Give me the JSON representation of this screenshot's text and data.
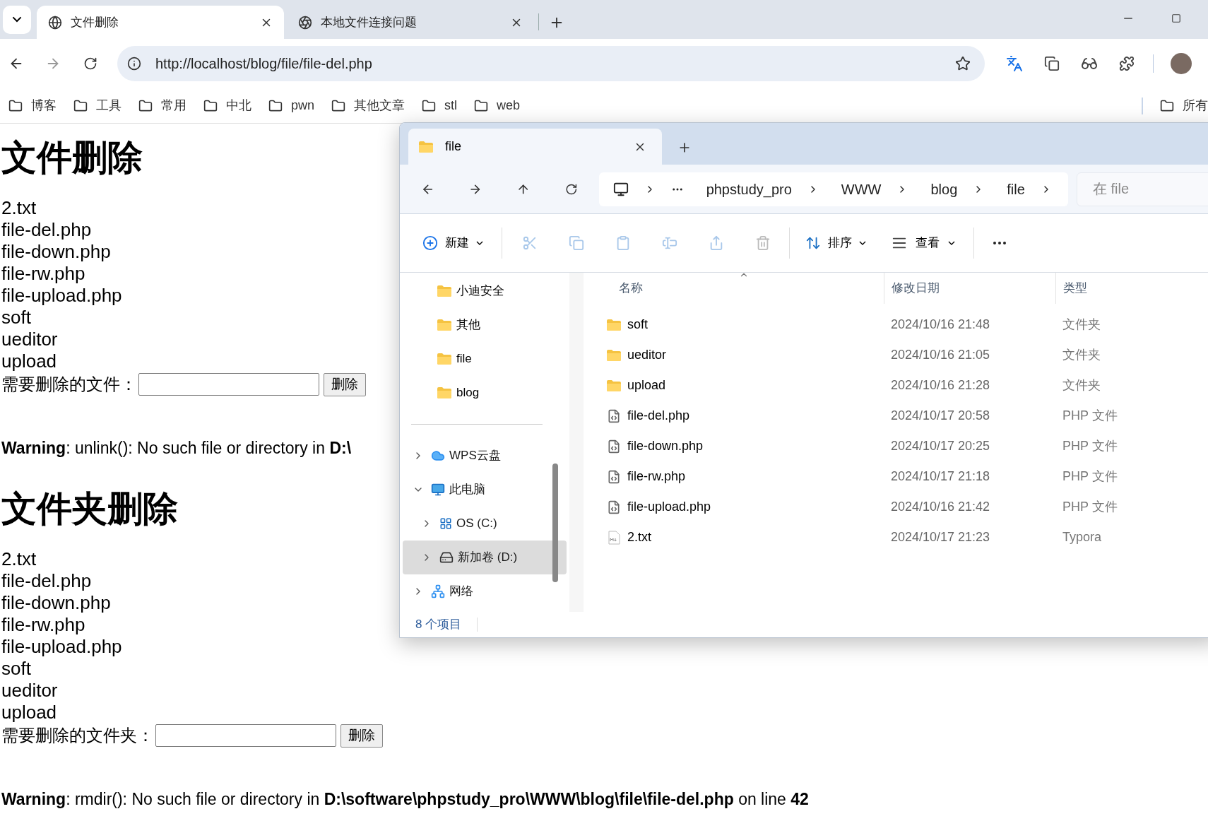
{
  "browser": {
    "tabs": [
      {
        "title": "文件删除",
        "selected": true,
        "kind": "globe"
      },
      {
        "title": "本地文件连接问题",
        "selected": false,
        "kind": "chat"
      }
    ],
    "address": "http://localhost/blog/file/file-del.php",
    "bookmarks": [
      "博客",
      "工具",
      "常用",
      "中北",
      "pwn",
      "其他文章",
      "stl",
      "web"
    ],
    "bookmark_overflow": "所有"
  },
  "page": {
    "sections": [
      {
        "heading": "文件删除",
        "items": [
          "2.txt",
          "file-del.php",
          "file-down.php",
          "file-rw.php",
          "file-upload.php",
          "soft",
          "ueditor",
          "upload"
        ],
        "prompt": "需要删除的文件：",
        "button": "删除",
        "warning": "**Warning**: unlink(): No such file or directory in **D:\\**"
      },
      {
        "heading": "文件夹删除",
        "items": [
          "2.txt",
          "file-del.php",
          "file-down.php",
          "file-rw.php",
          "file-upload.php",
          "soft",
          "ueditor",
          "upload"
        ],
        "prompt": "需要删除的文件夹：",
        "button": "删除",
        "warning": "**Warning**: rmdir(): No such file or directory in **D:\\software\\phpstudy_pro\\WWW\\blog\\file\\file-del.php** on line **42**"
      }
    ]
  },
  "explorer": {
    "tab_title": "file",
    "breadcrumb": [
      "phpstudy_pro",
      "WWW",
      "blog",
      "file"
    ],
    "search_placeholder": "在 file",
    "toolbar": {
      "new": "新建",
      "sort": "排序",
      "view": "查看"
    },
    "quick_access": [
      "小迪安全",
      "其他",
      "file",
      "blog"
    ],
    "tree": [
      {
        "label": "WPS云盘",
        "kind": "cloud",
        "expanded": false,
        "selected": false
      },
      {
        "label": "此电脑",
        "kind": "pc",
        "expanded": true,
        "selected": false,
        "children": [
          {
            "label": "OS (C:)",
            "kind": "windrive",
            "expanded": false,
            "selected": false
          },
          {
            "label": "新加卷 (D:)",
            "kind": "drive",
            "expanded": false,
            "selected": true
          }
        ]
      },
      {
        "label": "网络",
        "kind": "network",
        "expanded": false,
        "selected": false
      }
    ],
    "columns": [
      "名称",
      "修改日期",
      "类型"
    ],
    "rows": [
      {
        "name": "soft",
        "date": "2024/10/16 21:48",
        "type": "文件夹",
        "kind": "folder"
      },
      {
        "name": "ueditor",
        "date": "2024/10/16 21:05",
        "type": "文件夹",
        "kind": "folder"
      },
      {
        "name": "upload",
        "date": "2024/10/16 21:28",
        "type": "文件夹",
        "kind": "folder"
      },
      {
        "name": "file-del.php",
        "date": "2024/10/17 20:58",
        "type": "PHP 文件",
        "kind": "php"
      },
      {
        "name": "file-down.php",
        "date": "2024/10/17 20:25",
        "type": "PHP 文件",
        "kind": "php"
      },
      {
        "name": "file-rw.php",
        "date": "2024/10/17 21:18",
        "type": "PHP 文件",
        "kind": "php"
      },
      {
        "name": "file-upload.php",
        "date": "2024/10/16 21:42",
        "type": "PHP 文件",
        "kind": "php"
      },
      {
        "name": "2.txt",
        "date": "2024/10/17 21:23",
        "type": "Typora",
        "kind": "md"
      }
    ],
    "status": "8 个项目"
  }
}
